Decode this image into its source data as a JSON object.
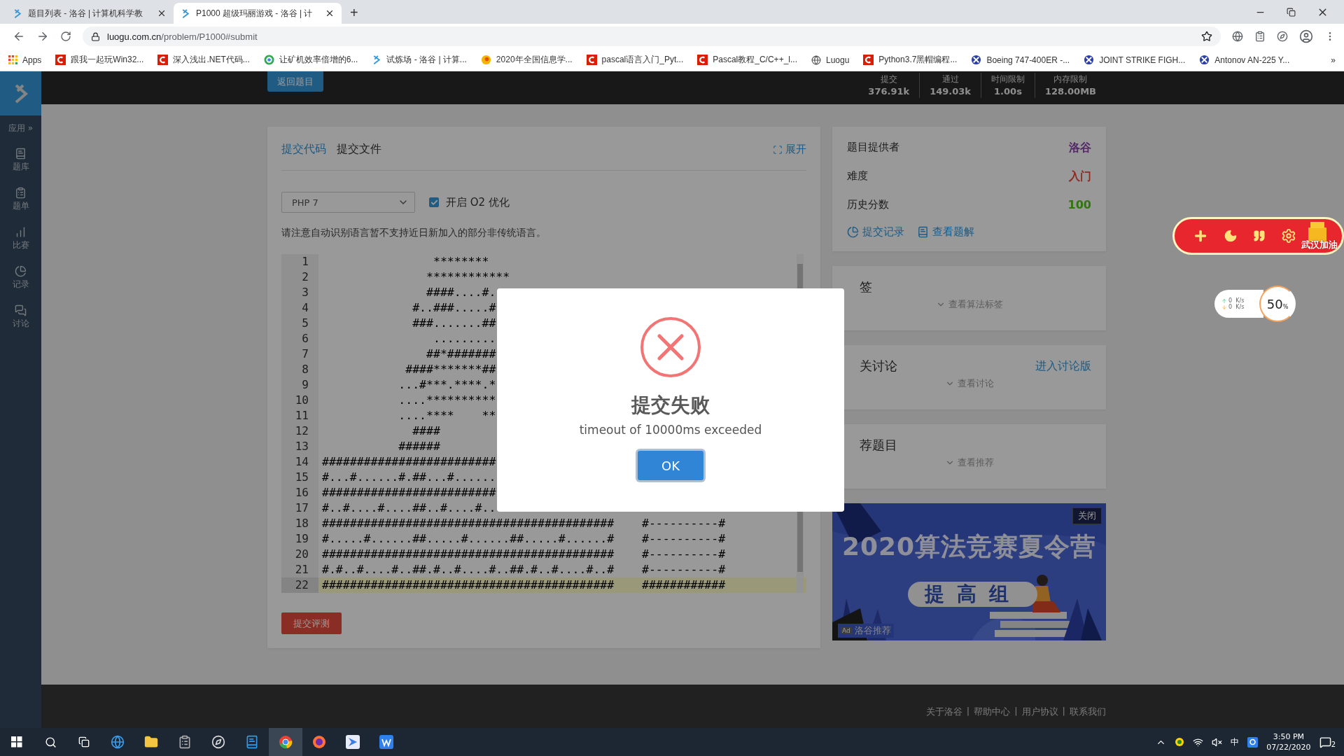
{
  "browser": {
    "tabs": [
      {
        "title": "题目列表 - 洛谷 | 计算机科学教",
        "selected": false
      },
      {
        "title": "P1000 超级玛丽游戏 - 洛谷 | 计",
        "selected": true
      }
    ],
    "new_tab": "+",
    "url": {
      "host": "luogu.com.cn",
      "path": "/problem/P1000#submit"
    },
    "bookmarks": [
      {
        "label": "Apps",
        "kind": "apps"
      },
      {
        "label": "跟我一起玩Win32...",
        "kind": "red"
      },
      {
        "label": "深入浅出.NET代码...",
        "kind": "red"
      },
      {
        "label": "让矿机效率倍增的6...",
        "kind": "ring"
      },
      {
        "label": "试炼场 - 洛谷 | 计算...",
        "kind": "luogu"
      },
      {
        "label": "2020年全国信息学...",
        "kind": "orange"
      },
      {
        "label": "pascal语言入门_Pyt...",
        "kind": "red"
      },
      {
        "label": "Pascal教程_C/C++_l...",
        "kind": "red"
      },
      {
        "label": "Luogu",
        "kind": "globe"
      },
      {
        "label": "Python3.7黑帽编程...",
        "kind": "red"
      },
      {
        "label": "Boeing 747-400ER -...",
        "kind": "planet"
      },
      {
        "label": "JOINT STRIKE FIGH...",
        "kind": "planet"
      },
      {
        "label": "Antonov AN-225 Y...",
        "kind": "planet"
      }
    ],
    "overflow": "»"
  },
  "sidebar": {
    "apps": "应用 »",
    "items": [
      {
        "label": "题库",
        "kind": "book"
      },
      {
        "label": "题单",
        "kind": "list"
      },
      {
        "label": "比赛",
        "kind": "bars"
      },
      {
        "label": "记录",
        "kind": "pie"
      },
      {
        "label": "讨论",
        "kind": "chat"
      }
    ]
  },
  "header": {
    "back": "返回题目",
    "stats": [
      {
        "label": "提交",
        "value": "376.91k"
      },
      {
        "label": "通过",
        "value": "149.03k"
      },
      {
        "label": "时间限制",
        "value": "1.00s"
      },
      {
        "label": "内存限制",
        "value": "128.00MB"
      }
    ]
  },
  "submit": {
    "tabs": [
      {
        "label": "提交代码",
        "selected": true
      },
      {
        "label": "提交文件",
        "selected": false
      }
    ],
    "expand": "展开",
    "language": "PHP 7",
    "o2": {
      "label": "开启 O2 优化",
      "checked": true
    },
    "notice": "请注意自动识别语言暂不支持近日新加入的部分非传统语言。",
    "editor": [
      {
        "n": "1",
        "text": "                ********",
        "current": false
      },
      {
        "n": "2",
        "text": "               ************",
        "current": false
      },
      {
        "n": "3",
        "text": "               ####....#.",
        "current": false
      },
      {
        "n": "4",
        "text": "             #..###.....#",
        "current": false
      },
      {
        "n": "5",
        "text": "             ###.......##",
        "current": false
      },
      {
        "n": "6",
        "text": "                .........",
        "current": false
      },
      {
        "n": "7",
        "text": "               ##*#######",
        "current": false
      },
      {
        "n": "8",
        "text": "            ####*******##",
        "current": false
      },
      {
        "n": "9",
        "text": "           ...#***.****.*",
        "current": false
      },
      {
        "n": "10",
        "text": "           ....**********",
        "current": false
      },
      {
        "n": "11",
        "text": "           ....****    **",
        "current": false
      },
      {
        "n": "12",
        "text": "             ####",
        "current": false
      },
      {
        "n": "13",
        "text": "           ######",
        "current": false
      },
      {
        "n": "14",
        "text": "#########################",
        "current": false
      },
      {
        "n": "15",
        "text": "#...#......#.##...#......",
        "current": false
      },
      {
        "n": "16",
        "text": "#########################",
        "current": false
      },
      {
        "n": "17",
        "text": "#..#....#....##..#....#..",
        "current": false
      },
      {
        "n": "18",
        "text": "##########################################    #----------#",
        "current": false
      },
      {
        "n": "19",
        "text": "#.....#......##.....#......##.....#......#    #----------#",
        "current": false
      },
      {
        "n": "20",
        "text": "##########################################    #----------#",
        "current": false
      },
      {
        "n": "21",
        "text": "#.#..#....#..##.#..#....#..##.#..#....#..#    #----------#",
        "current": false
      },
      {
        "n": "22",
        "text": "##########################################    ############",
        "current": true
      }
    ],
    "button": "提交评测"
  },
  "info": {
    "rows": [
      {
        "label": "题目提供者",
        "value": "洛谷",
        "kind": "user"
      },
      {
        "label": "难度",
        "value": "入门",
        "kind": "difficulty"
      },
      {
        "label": "历史分数",
        "value": "100",
        "kind": "score"
      }
    ],
    "links": [
      {
        "label": "提交记录",
        "kind": "pie"
      },
      {
        "label": "查看题解",
        "kind": "book"
      }
    ]
  },
  "panels": [
    {
      "title": "签",
      "toggle": "查看算法标签"
    },
    {
      "title": "关讨论",
      "link": "进入讨论版",
      "toggle": "查看讨论"
    },
    {
      "title": "荐题目",
      "toggle": "查看推荐"
    }
  ],
  "ad": {
    "kind": "picture",
    "headline": "2020算法竞赛夏令营",
    "group": "提高组",
    "tag": "Ad",
    "source": "洛谷推荐",
    "close": "关闭"
  },
  "footer": {
    "links": [
      "关于洛谷",
      "帮助中心",
      "用户协议",
      "联系我们"
    ],
    "separator": "|"
  },
  "dialog": {
    "title": "提交失败",
    "message": "timeout of 10000ms exceeded",
    "button": "OK"
  },
  "extension": {
    "badge": "武汉加油",
    "speed": [
      {
        "kind": "up",
        "value": "0",
        "unit": "K/s"
      },
      {
        "kind": "down",
        "value": "0",
        "unit": "K/s"
      }
    ],
    "percent": "50",
    "percent_unit": "%"
  },
  "taskbar": {
    "ime": "中",
    "time": "3:50 PM",
    "date": "07/22/2020",
    "notifications": "2"
  }
}
